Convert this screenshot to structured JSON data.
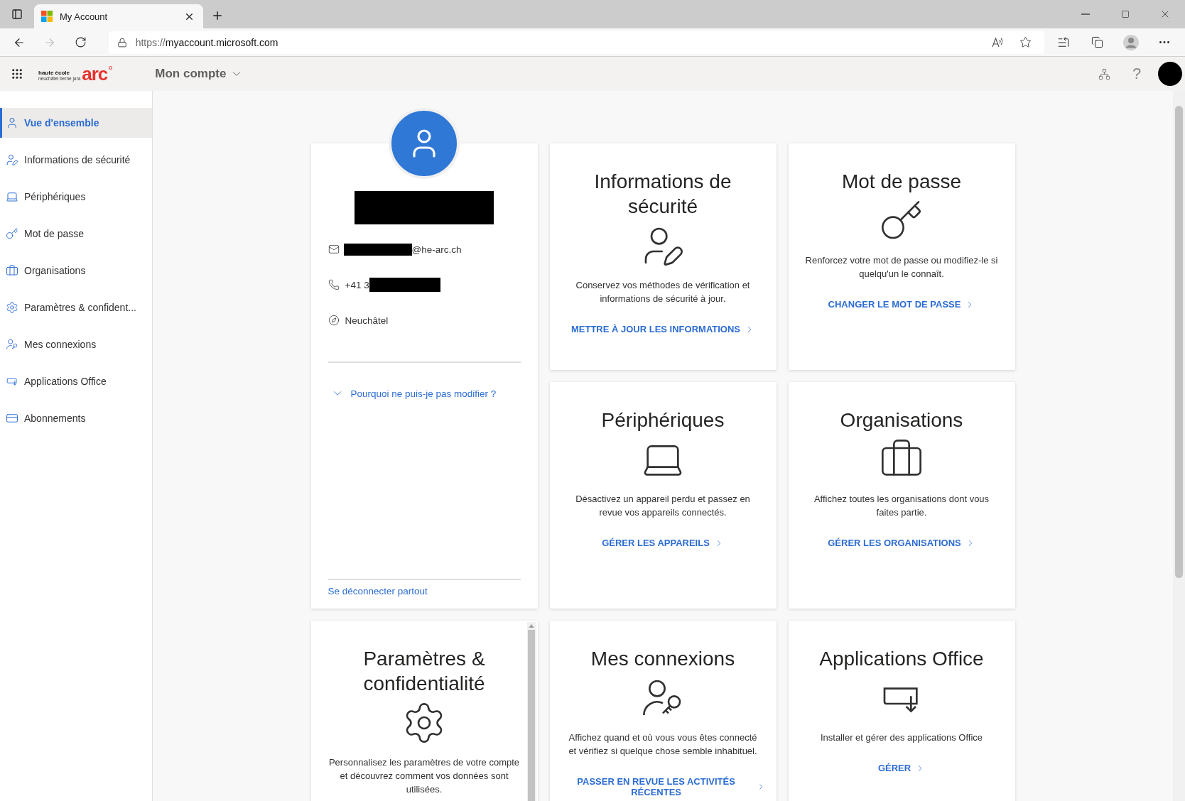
{
  "browser": {
    "tab_title": "My Account",
    "url_scheme": "https://",
    "url_host": "myaccount.microsoft.com",
    "forward_disabled": true
  },
  "header": {
    "brand": {
      "line_1": "haute école",
      "line_2": "neuchâtel berne jura",
      "mark": "arc"
    },
    "app_title": "Mon compte",
    "help": "?"
  },
  "sidebar": {
    "items": [
      {
        "label": "Vue d'ensemble",
        "selected": true
      },
      {
        "label": "Informations de sécurité",
        "selected": false
      },
      {
        "label": "Périphériques",
        "selected": false
      },
      {
        "label": "Mot de passe",
        "selected": false
      },
      {
        "label": "Organisations",
        "selected": false
      },
      {
        "label": "Paramètres & confident...",
        "selected": false
      },
      {
        "label": "Mes connexions",
        "selected": false
      },
      {
        "label": "Applications Office",
        "selected": false
      },
      {
        "label": "Abonnements",
        "selected": false
      }
    ]
  },
  "profile": {
    "email_suffix": "@he-arc.ch",
    "phone_prefix": "+41 3",
    "location": "Neuchâtel",
    "why_link": "Pourquoi ne puis-je pas modifier ?",
    "sign_out": "Se déconnecter partout"
  },
  "cards": [
    {
      "kind": "plain",
      "title": "Informations de sécurité",
      "description": "Conservez vos méthodes de vérification et informations de sécurité à jour.",
      "action": "METTRE À JOUR LES INFORMATIONS"
    },
    {
      "kind": "plain",
      "title": "Mot de passe",
      "description": "Renforcez votre mot de passe ou modifiez-le si quelqu'un le connaît.",
      "action": "CHANGER LE MOT DE PASSE"
    },
    {
      "kind": "plain",
      "title": "Périphériques",
      "description": "Désactivez un appareil perdu et passez en revue vos appareils connectés.",
      "action": "GÉRER LES APPAREILS"
    },
    {
      "kind": "plain",
      "title": "Organisations",
      "description": "Affichez toutes les organisations dont vous faites partie.",
      "action": "GÉRER LES ORGANISATIONS"
    },
    {
      "kind": "scrollable",
      "title": "Paramètres & confidentialité",
      "description": "Personnalisez les paramètres de votre compte et découvrez comment vos données sont utilisées."
    },
    {
      "kind": "plain",
      "title": "Mes connexions",
      "description": "Affichez quand et où vous vous êtes connecté et vérifiez si quelque chose semble inhabituel.",
      "action": "PASSER EN REVUE LES ACTIVITÉS RÉCENTES"
    },
    {
      "kind": "plain",
      "title": "Applications Office",
      "description": "Installer et gérer des applications Office",
      "action": "GÉRER"
    }
  ]
}
